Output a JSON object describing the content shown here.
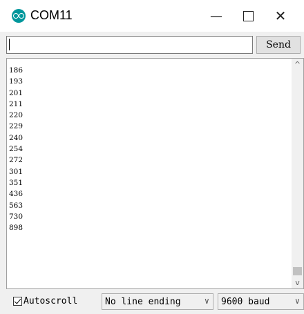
{
  "window": {
    "title": "COM11",
    "icon": "arduino-logo-icon",
    "minimize_glyph": "—",
    "close_glyph": "✕"
  },
  "send_row": {
    "input_value": "",
    "send_label": "Send"
  },
  "output": {
    "lines": [
      "186",
      "193",
      "201",
      "211",
      "220",
      "229",
      "240",
      "254",
      "272",
      "301",
      "351",
      "436",
      "563",
      "730",
      "898"
    ],
    "scroll_up_glyph": "^",
    "scroll_down_glyph": "v"
  },
  "bottom": {
    "autoscroll_label": "Autoscroll",
    "autoscroll_checked": true,
    "line_ending_value": "No line ending",
    "baud_value": "9600 baud",
    "chevron_glyph": "∨"
  },
  "colors": {
    "accent": "#00979c",
    "window_bg": "#f0f0f0",
    "output_bg": "#ffffff"
  }
}
